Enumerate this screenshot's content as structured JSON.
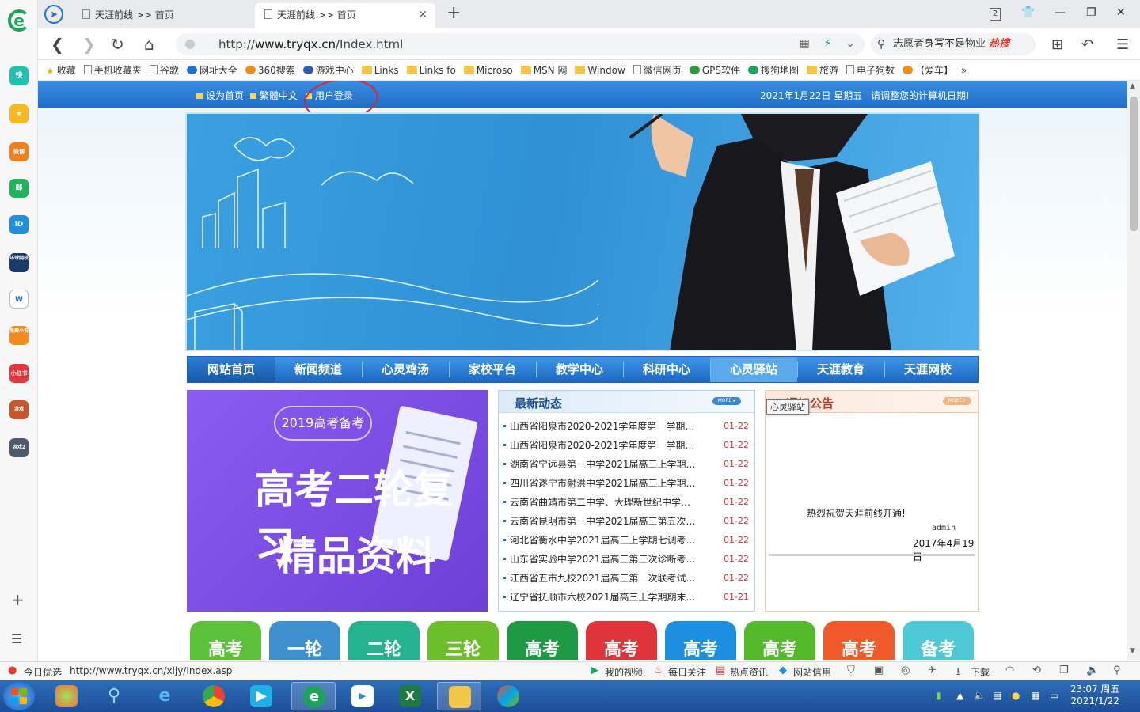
{
  "sidebar": {
    "apps": [
      "快",
      "★",
      "微博",
      "邮",
      "iD",
      "环球网校",
      "W",
      "免费小说",
      "小红书",
      "游戏",
      "游戏2"
    ],
    "add_icon": "plus-icon",
    "list_icon": "list-icon"
  },
  "tabs": [
    {
      "label": "天涯前线 >> 首页",
      "active": false
    },
    {
      "label": "天涯前线 >> 首页",
      "active": true
    }
  ],
  "window": {
    "badge": "2"
  },
  "address": {
    "prefix": "http://",
    "host": "www.tryqx.cn",
    "path": "/Index.html"
  },
  "search": {
    "text": "志愿者身写不是物业",
    "hot": "热搜"
  },
  "bookmarks": [
    {
      "label": "收藏",
      "icon": "star"
    },
    {
      "label": "手机收藏夹",
      "icon": "page"
    },
    {
      "label": "谷歌",
      "icon": "page"
    },
    {
      "label": "网址大全",
      "icon": "dot"
    },
    {
      "label": "360搜索",
      "icon": "dot"
    },
    {
      "label": "游戏中心",
      "icon": "dot"
    },
    {
      "label": "Links",
      "icon": "folder"
    },
    {
      "label": "Links fo",
      "icon": "folder"
    },
    {
      "label": "Microso",
      "icon": "folder"
    },
    {
      "label": "MSN 网",
      "icon": "folder"
    },
    {
      "label": "Window",
      "icon": "folder"
    },
    {
      "label": "微信网页",
      "icon": "page"
    },
    {
      "label": "GPS软件",
      "icon": "dot"
    },
    {
      "label": "搜狗地图",
      "icon": "dot"
    },
    {
      "label": "旅游",
      "icon": "folder"
    },
    {
      "label": "电子狗数",
      "icon": "page"
    },
    {
      "label": "【爱车】",
      "icon": "dot"
    },
    {
      "label": "»",
      "icon": "none"
    }
  ],
  "page": {
    "top_links": [
      "设为首页",
      "繁體中文",
      "用户登录"
    ],
    "date_text": "2021年1月22日  星期五",
    "calc_notice": "请调整您的计算机日期!",
    "nav": [
      "网站首页",
      "新闻频道",
      "心灵鸡汤",
      "家校平台",
      "教学中心",
      "科研中心",
      "心灵驿站",
      "天涯教育",
      "天涯网校"
    ],
    "promo": {
      "badge": "2019高考备考",
      "line1": "高考二轮复习",
      "line2": "精品资料"
    },
    "news": {
      "title": "最新动态",
      "more": "MORE ▸",
      "items": [
        {
          "text": "山西省阳泉市2020-2021学年度第一学期高…",
          "date": "01-22"
        },
        {
          "text": "山西省阳泉市2020-2021学年度第一学期高…",
          "date": "01-22"
        },
        {
          "text": "湖南省宁远县第一中学2021届高三上学期…",
          "date": "01-22"
        },
        {
          "text": "四川省遂宁市射洪中学2021届高三上学期…",
          "date": "01-22"
        },
        {
          "text": "云南省曲靖市第二中学、大理新世纪中学…",
          "date": "01-22"
        },
        {
          "text": "云南省昆明市第一中学2021届高三第五次…",
          "date": "01-22"
        },
        {
          "text": "河北省衡水中学2021届高三上学期七调考…",
          "date": "01-22"
        },
        {
          "text": "山东省实验中学2021届高三第三次诊断考…",
          "date": "01-22"
        },
        {
          "text": "江西省五市九校2021届高三第一次联考试…",
          "date": "01-22"
        },
        {
          "text": "辽宁省抚顺市六校2021届高三上学期期末…",
          "date": "01-21"
        }
      ]
    },
    "notice": {
      "title": "通知公告",
      "more": "MORE+",
      "tooltip": "心灵驿站",
      "message": "热烈祝贺天涯前线开通!",
      "author": "admin",
      "date": "2017年4月19日"
    },
    "tiles": [
      {
        "label": "高考",
        "color": "#5cc13a"
      },
      {
        "label": "一轮",
        "color": "#3e8fce"
      },
      {
        "label": "二轮",
        "color": "#25b28f"
      },
      {
        "label": "三轮",
        "color": "#6cbf2b"
      },
      {
        "label": "高考",
        "color": "#1e9a45"
      },
      {
        "label": "高考",
        "color": "#e0343b"
      },
      {
        "label": "高考",
        "color": "#1c8fe0"
      },
      {
        "label": "高考",
        "color": "#55b92c"
      },
      {
        "label": "高考",
        "color": "#f0592a"
      },
      {
        "label": "备考",
        "color": "#4dc9d6"
      }
    ]
  },
  "status": {
    "today": "今日优选",
    "url": "http://www.tryqx.cn/xljy/Index.asp",
    "video": "我的视频",
    "daily": "每日关注",
    "hot": "热点资讯",
    "credit": "网站信用",
    "download": "下载"
  },
  "taskbar": {
    "time": "23:07 周五",
    "date": "2021/1/22"
  }
}
